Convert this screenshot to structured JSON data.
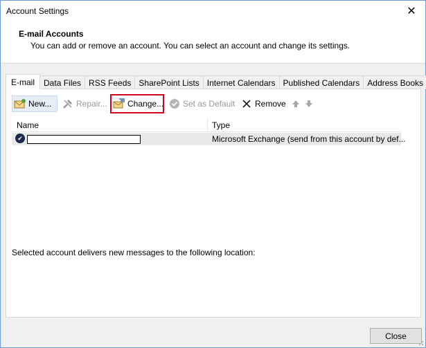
{
  "window": {
    "title": "Account Settings",
    "close_glyph": "✕"
  },
  "header": {
    "title": "E-mail Accounts",
    "description": "You can add or remove an account. You can select an account and change its settings."
  },
  "tabs": [
    {
      "label": "E-mail",
      "active": true
    },
    {
      "label": "Data Files"
    },
    {
      "label": "RSS Feeds"
    },
    {
      "label": "SharePoint Lists"
    },
    {
      "label": "Internet Calendars"
    },
    {
      "label": "Published Calendars"
    },
    {
      "label": "Address Books"
    }
  ],
  "toolbar": {
    "new_label": "New...",
    "repair_label": "Repair...",
    "change_label": "Change...",
    "set_default_label": "Set as Default",
    "remove_label": "Remove",
    "highlight_color": "#d0021b"
  },
  "accounts_list": {
    "columns": {
      "name": "Name",
      "type": "Type"
    },
    "rows": [
      {
        "name": "",
        "type": "Microsoft Exchange (send from this account by def..."
      }
    ]
  },
  "delivery_text": "Selected account delivers new messages to the following location:",
  "footer": {
    "close_label": "Close"
  }
}
